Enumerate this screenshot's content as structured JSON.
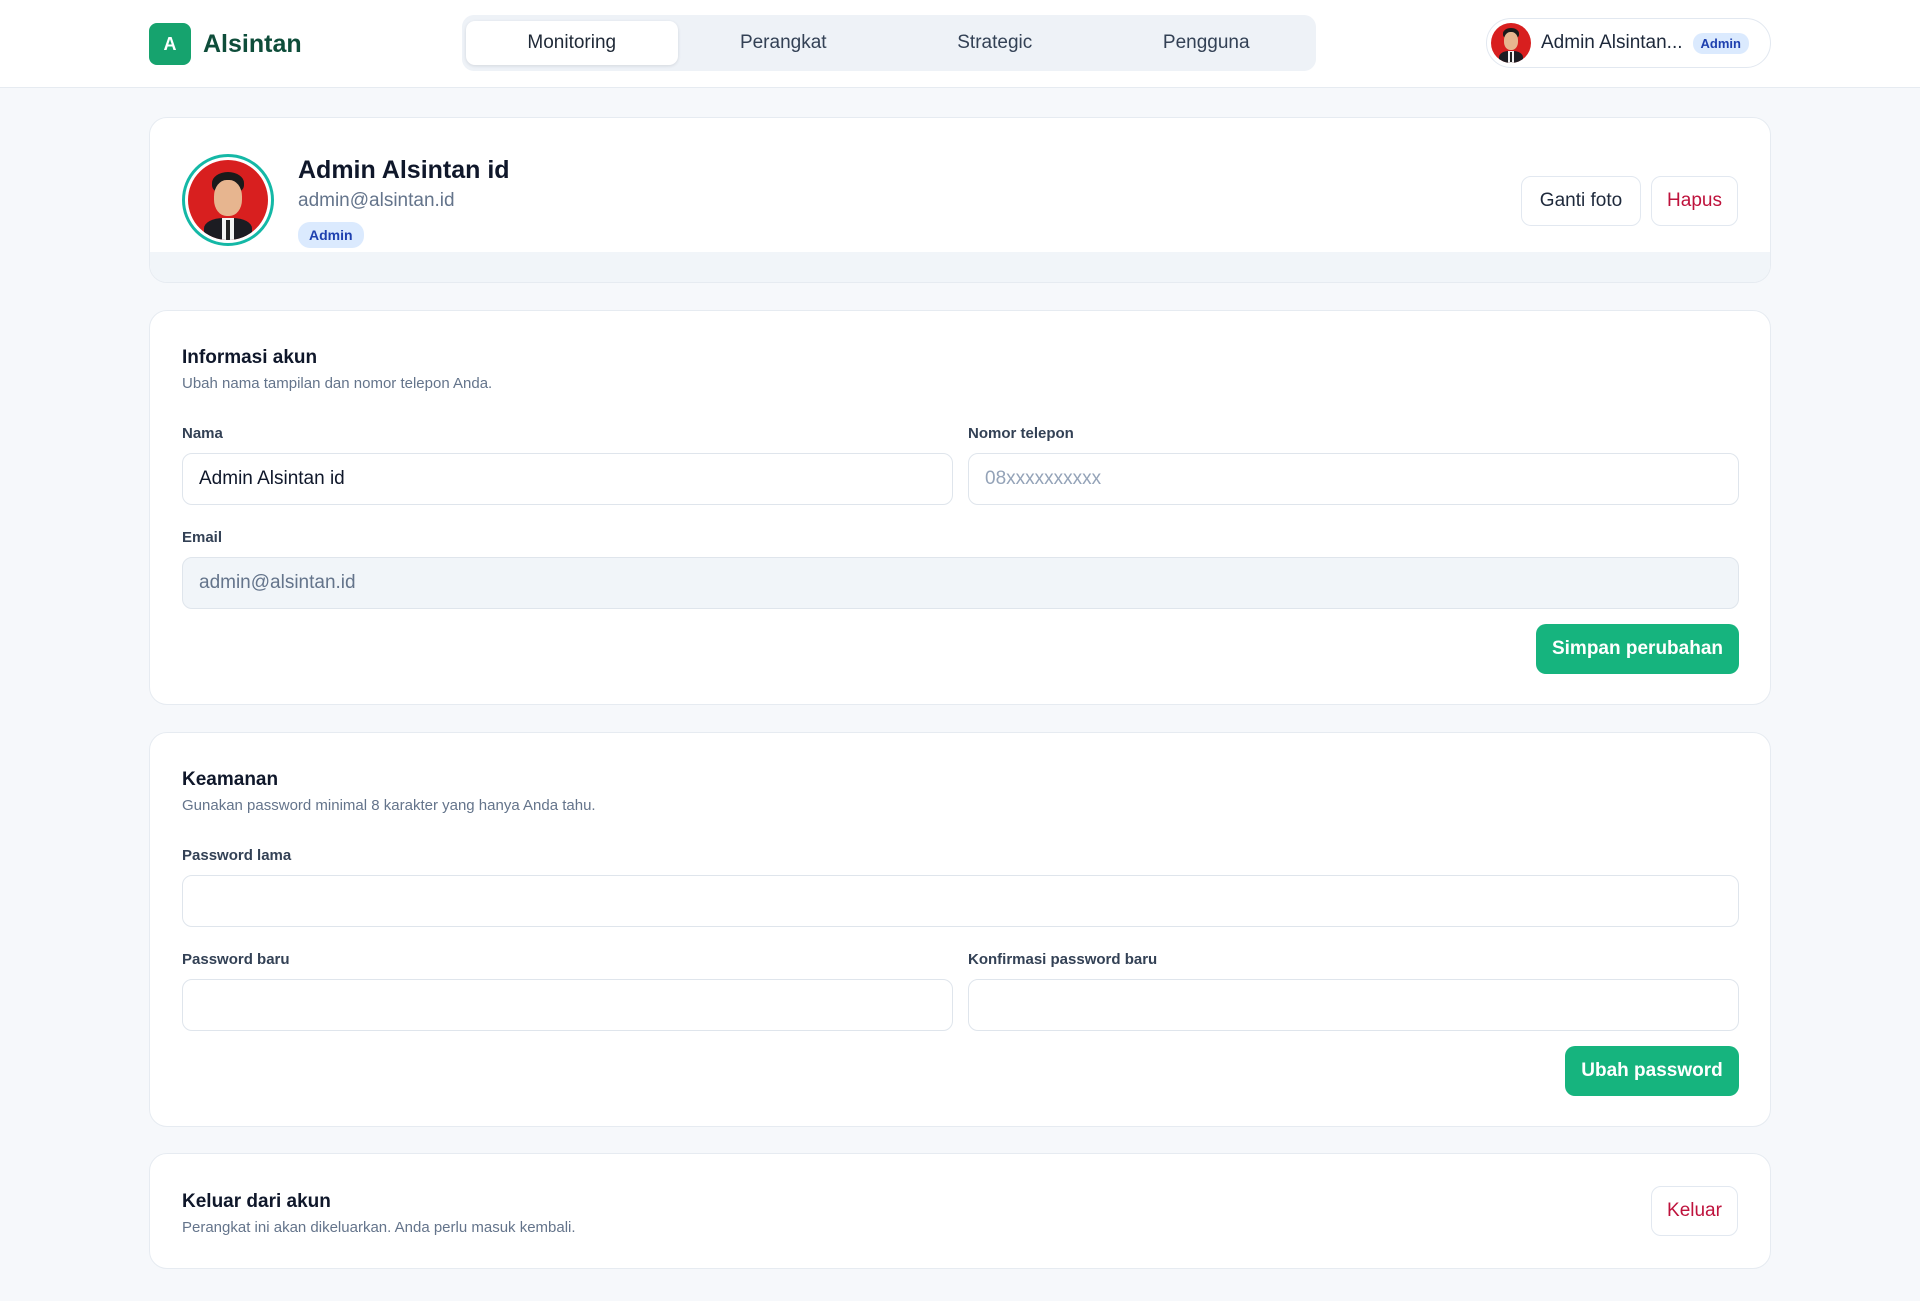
{
  "brand": {
    "logo_letter": "A",
    "name": "Alsintan"
  },
  "nav": {
    "tabs": [
      {
        "label": "Monitoring",
        "active": true
      },
      {
        "label": "Perangkat",
        "active": false
      },
      {
        "label": "Strategic",
        "active": false
      },
      {
        "label": "Pengguna",
        "active": false
      }
    ]
  },
  "user_chip": {
    "name": "Admin Alsintan...",
    "role": "Admin"
  },
  "profile": {
    "name": "Admin Alsintan id",
    "email": "admin@alsintan.id",
    "role": "Admin",
    "change_photo_label": "Ganti foto",
    "delete_label": "Hapus"
  },
  "account_info": {
    "title": "Informasi akun",
    "subtitle": "Ubah nama tampilan dan nomor telepon Anda.",
    "name_label": "Nama",
    "name_value": "Admin Alsintan id",
    "phone_label": "Nomor telepon",
    "phone_placeholder": "08xxxxxxxxxx",
    "email_label": "Email",
    "email_value": "admin@alsintan.id",
    "save_label": "Simpan perubahan"
  },
  "security": {
    "title": "Keamanan",
    "subtitle": "Gunakan password minimal 8 karakter yang hanya Anda tahu.",
    "old_password_label": "Password lama",
    "new_password_label": "Password baru",
    "confirm_password_label": "Konfirmasi password baru",
    "change_password_label": "Ubah password"
  },
  "logout": {
    "title": "Keluar dari akun",
    "subtitle": "Perangkat ini akan dikeluarkan. Anda perlu masuk kembali.",
    "button_label": "Keluar"
  },
  "colors": {
    "accent": "#16b47e",
    "brand_text": "#0e4d3a",
    "danger": "#be123c",
    "role_badge_bg": "#dbeafe",
    "avatar_ring": "#14b8a6"
  }
}
